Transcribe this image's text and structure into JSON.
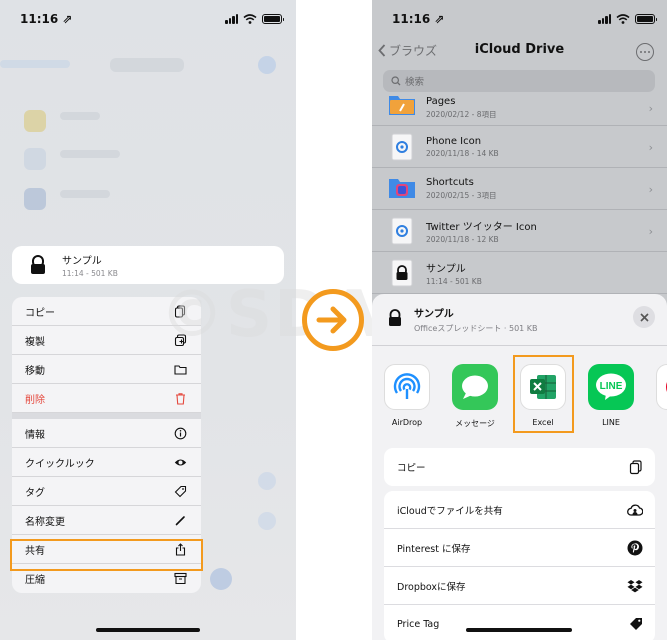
{
  "left_phone": {
    "status": {
      "time": "11:16 ⇗"
    },
    "preview": {
      "name": "サンプル",
      "meta": "11:14 - 501 KB"
    },
    "menu": {
      "group1": [
        {
          "label": "コピー",
          "icon": "copy-icon"
        },
        {
          "label": "複製",
          "icon": "duplicate-icon"
        },
        {
          "label": "移動",
          "icon": "folder-icon"
        },
        {
          "label": "削除",
          "icon": "trash-icon",
          "danger": true
        }
      ],
      "group2": [
        {
          "label": "情報",
          "icon": "info-icon"
        },
        {
          "label": "クイックルック",
          "icon": "eye-icon"
        },
        {
          "label": "タグ",
          "icon": "tag-icon"
        },
        {
          "label": "名称変更",
          "icon": "pencil-icon"
        },
        {
          "label": "共有",
          "icon": "share-icon",
          "highlighted": true
        },
        {
          "label": "圧縮",
          "icon": "archive-icon"
        }
      ]
    }
  },
  "watermark": "©SDAPP",
  "right_phone": {
    "status": {
      "time": "11:16 ⇗"
    },
    "nav": {
      "back": "ブラウズ",
      "title": "iCloud Drive"
    },
    "search": {
      "placeholder": "検索"
    },
    "files": [
      {
        "name": "Pages",
        "meta": "2020/02/12 - 8項目",
        "icon": "folder-icon"
      },
      {
        "name": "Phone Icon",
        "meta": "2020/11/18 - 14 KB",
        "icon": "image-file-icon"
      },
      {
        "name": "Shortcuts",
        "meta": "2020/02/15 - 3項目",
        "icon": "shortcuts-folder-icon"
      },
      {
        "name": "Twitter ツイッター Icon",
        "meta": "2020/11/18 - 12 KB",
        "icon": "image-file-icon"
      },
      {
        "name": "サンプル",
        "meta": "11:14 - 501 KB",
        "icon": "lock-icon"
      }
    ],
    "share_sheet": {
      "file": {
        "name": "サンプル",
        "meta": "Officeスプレッドシート · 501 KB"
      },
      "apps": [
        {
          "label": "AirDrop",
          "icon": "airdrop-icon"
        },
        {
          "label": "メッセージ",
          "icon": "messages-icon"
        },
        {
          "label": "Excel",
          "icon": "excel-icon",
          "highlighted": true
        },
        {
          "label": "LINE",
          "icon": "line-icon"
        },
        {
          "label": "P",
          "icon": "pinterest-icon"
        }
      ],
      "copy": {
        "label": "コピー",
        "icon": "copy-icon"
      },
      "actions": [
        {
          "label": "iCloudでファイルを共有",
          "icon": "icloud-share-icon"
        },
        {
          "label": "Pinterest に保存",
          "icon": "pinterest-icon"
        },
        {
          "label": "Dropboxに保存",
          "icon": "dropbox-icon"
        },
        {
          "label": "Price Tag",
          "icon": "tag-icon"
        }
      ]
    }
  },
  "colors": {
    "highlight": "#f39a1e",
    "danger": "#e5483d",
    "excel": "#1e7145",
    "line": "#06c755",
    "messages": "#34c759",
    "pinterest": "#e60023"
  }
}
